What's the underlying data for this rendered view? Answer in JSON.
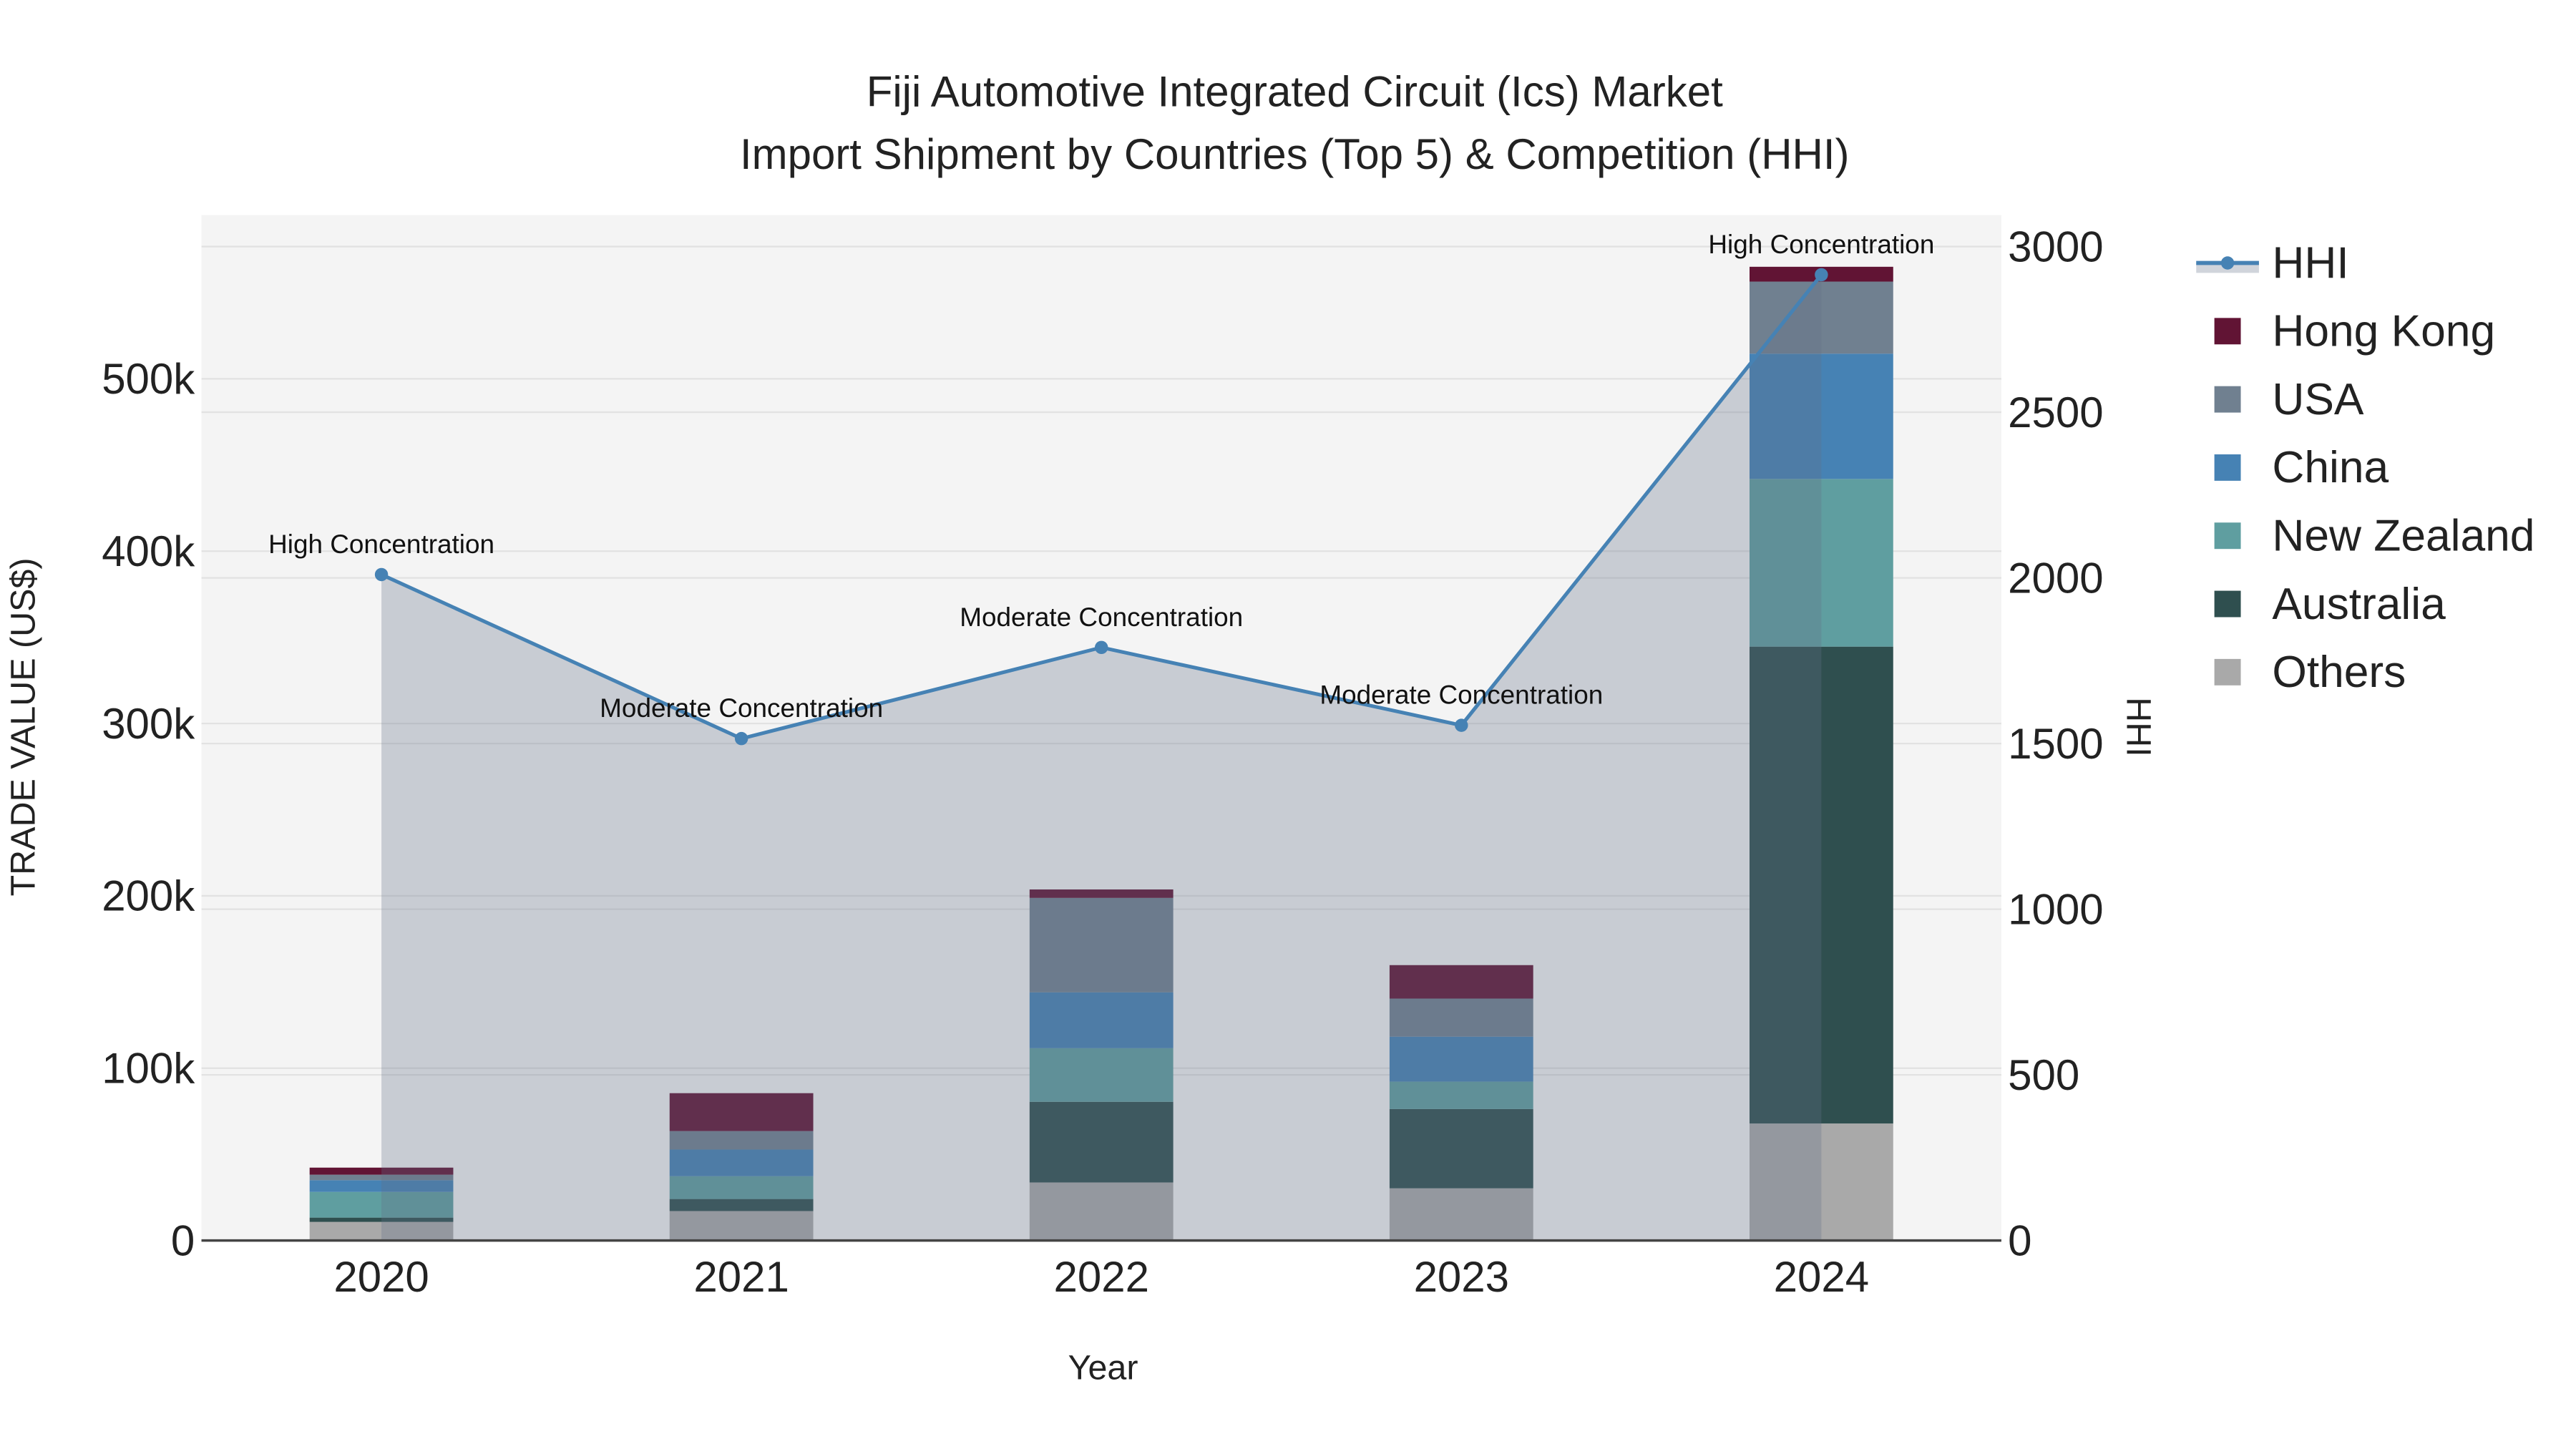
{
  "chart_data": {
    "type": "bar",
    "title": "Fiji Automotive Integrated Circuit (Ics) Market",
    "subtitle": "Import Shipment by Countries (Top 5) & Competition (HHI)",
    "xlabel": "Year",
    "ylabel": "TRADE VALUE (US$)",
    "y2label": "HHI",
    "categories": [
      "2020",
      "2021",
      "2022",
      "2023",
      "2024"
    ],
    "ylim": [
      0,
      595000
    ],
    "y2lim": [
      0,
      3095
    ],
    "yticks": [
      {
        "v": 0,
        "label": "0"
      },
      {
        "v": 100000,
        "label": "100k"
      },
      {
        "v": 200000,
        "label": "200k"
      },
      {
        "v": 300000,
        "label": "300k"
      },
      {
        "v": 400000,
        "label": "400k"
      },
      {
        "v": 500000,
        "label": "500k"
      }
    ],
    "y2ticks": [
      {
        "v": 0,
        "label": "0"
      },
      {
        "v": 500,
        "label": "500"
      },
      {
        "v": 1000,
        "label": "1000"
      },
      {
        "v": 1500,
        "label": "1500"
      },
      {
        "v": 2000,
        "label": "2000"
      },
      {
        "v": 2500,
        "label": "2500"
      },
      {
        "v": 3000,
        "label": "3000"
      }
    ],
    "grid": true,
    "legend_position": "right",
    "stacked": true,
    "series": [
      {
        "name": "Others",
        "color": "#A9A9A9",
        "values": [
          10800,
          17100,
          33700,
          30300,
          67900
        ]
      },
      {
        "name": "Australia",
        "color": "#2F4F4F",
        "values": [
          2500,
          7000,
          46800,
          46000,
          276700
        ]
      },
      {
        "name": "New Zealand",
        "color": "#5F9EA0",
        "values": [
          14900,
          13200,
          31100,
          15900,
          97300
        ]
      },
      {
        "name": "China",
        "color": "#4682B4",
        "values": [
          6800,
          15500,
          32400,
          26100,
          72700
        ]
      },
      {
        "name": "USA",
        "color": "#708090",
        "values": [
          3200,
          10700,
          54800,
          22100,
          41800
        ]
      },
      {
        "name": "Hong Kong",
        "color": "#611434",
        "values": [
          4100,
          22000,
          4900,
          19400,
          8600
        ]
      }
    ],
    "hhi": {
      "name": "HHI",
      "color": "#4682B4",
      "values": [
        2010,
        1515,
        1790,
        1555,
        2915
      ],
      "annotations": [
        "High Concentration",
        "Moderate Concentration",
        "Moderate Concentration",
        "Moderate Concentration",
        "High Concentration"
      ]
    },
    "legend_order": [
      "HHI",
      "Hong Kong",
      "USA",
      "China",
      "New Zealand",
      "Australia",
      "Others"
    ]
  }
}
